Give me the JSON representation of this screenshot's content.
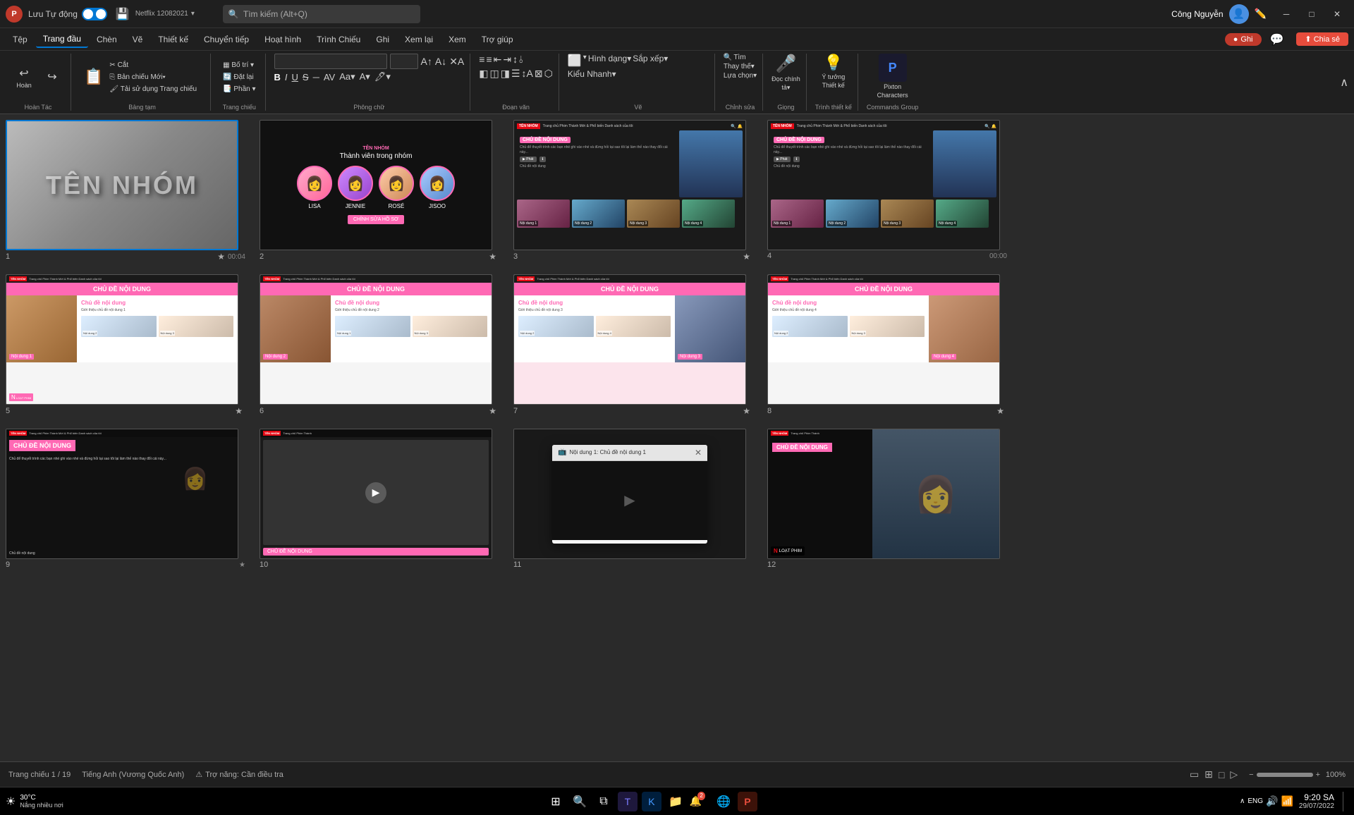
{
  "titlebar": {
    "logo": "P",
    "autosave_label": "Lưu Tự động",
    "save_icon": "💾",
    "filename": "Netflix 12082021",
    "dropdown_icon": "▾",
    "search_placeholder": "Tìm kiếm (Alt+Q)",
    "username": "Công Nguyễn",
    "minimize": "─",
    "maximize": "□",
    "close": "✕"
  },
  "menubar": {
    "items": [
      "Tệp",
      "Trang đầu",
      "Chèn",
      "Vẽ",
      "Thiết kế",
      "Chuyển tiếp",
      "Hoạt hình",
      "Trình Chiếu",
      "Ghi",
      "Xem lại",
      "Xem",
      "Trợ giúp"
    ],
    "active": "Trang đầu",
    "record_btn": "● Ghi",
    "comment_icon": "💬",
    "share_btn": "⬆ Chia sẻ"
  },
  "ribbon": {
    "undo": "↩",
    "redo": "↪",
    "groups": [
      {
        "name": "Hoàn Tác"
      },
      {
        "name": "Bảng tạm"
      },
      {
        "name": "Trang chiếu"
      },
      {
        "name": "Phông chữ"
      },
      {
        "name": "Đoạn văn"
      },
      {
        "name": "Vẽ"
      },
      {
        "name": "Chỉnh sửa"
      },
      {
        "name": "Giọng"
      },
      {
        "name": "Trình thiết kế"
      },
      {
        "name": "Commands Group"
      }
    ],
    "font_name": "",
    "font_size": "",
    "bold": "B",
    "italic": "I",
    "underline": "U",
    "strikethrough": "S"
  },
  "slides": [
    {
      "num": 1,
      "time": "00:04",
      "has_star": true,
      "type": "cover",
      "title": "TÊN NHÓM"
    },
    {
      "num": 2,
      "time": "",
      "has_star": true,
      "type": "members",
      "title": "Thành viên trong nhóm",
      "members": [
        "LISA",
        "JENNIE",
        "ROSÉ",
        "JISOO"
      ],
      "btn": "CHỈNH SỬA HỒ SƠ"
    },
    {
      "num": 3,
      "time": "",
      "has_star": true,
      "type": "netflix",
      "subject": "CHỦ ĐỀ NỘI DUNG",
      "thumbs": [
        "Nội dung 1",
        "Nội dung 2",
        "Nội dung 3",
        "Nội dung 4"
      ]
    },
    {
      "num": 4,
      "time": "00:00",
      "has_star": false,
      "type": "netflix",
      "subject": "CHỦ ĐỀ NỘI DUNG",
      "thumbs": [
        "Nội dung 1",
        "Nội dung 2",
        "Nội dung 3",
        "Nội dung 4"
      ]
    },
    {
      "num": 5,
      "time": "",
      "has_star": true,
      "type": "content",
      "subject": "CHỦ ĐỀ NỘI DUNG",
      "subtitle": "Chủ đề nội dung",
      "label": "Nội dung 1",
      "thumbs": [
        "Nội dung 2",
        "Nội dung 3"
      ]
    },
    {
      "num": 6,
      "time": "",
      "has_star": true,
      "type": "content",
      "subject": "CHỦ ĐỀ NỘI DUNG",
      "subtitle": "Chủ đề nội dung",
      "label": "Nội dung 2",
      "thumbs": [
        "Nội dung 1",
        "Nội dung 3"
      ]
    },
    {
      "num": 7,
      "time": "",
      "has_star": true,
      "type": "content",
      "subject": "CHỦ ĐỀ NỘI DUNG",
      "subtitle": "Chủ đề nội dung",
      "label": "Nội dung 3",
      "thumbs": [
        "Nội dung 2",
        "Nội dung 4"
      ]
    },
    {
      "num": 8,
      "time": "",
      "has_star": true,
      "type": "content",
      "subject": "CHỦ ĐỀ NỘI DUNG",
      "subtitle": "Chủ đề nội dung",
      "label": "Nội dung 4",
      "thumbs": [
        "Nội dung 2",
        "Nội dung 3"
      ]
    },
    {
      "num": 9,
      "time": "",
      "has_star": false,
      "type": "content-only",
      "subject": "CHỦ ĐỀ NỘI DUNG"
    },
    {
      "num": 10,
      "time": "",
      "has_star": false,
      "type": "content-movie",
      "subject": "CHỦ ĐỀ NỘI DUNG"
    },
    {
      "num": 11,
      "time": "",
      "has_star": false,
      "type": "video-popup",
      "popup_title": "Nội dung 1: Chủ đề nội dung 1"
    },
    {
      "num": 12,
      "time": "",
      "has_star": false,
      "type": "content-movie2",
      "subject": "CHỦ ĐỀ NỘI DUNG"
    }
  ],
  "statusbar": {
    "slide_info": "Trang chiếu 1 / 19",
    "language": "Tiếng Anh (Vương Quốc Anh)",
    "accessibility": "Trợ năng: Cần điều tra",
    "view_normal": "▭",
    "view_slide_sorter": "⊞",
    "view_reading": "□",
    "view_slideshow": "▷",
    "zoom": "100%"
  },
  "taskbar": {
    "weather_temp": "30°C",
    "weather_desc": "Nắng nhiều nơi",
    "time": "9:20 SA",
    "date": "29/07/2022",
    "lang": "ENG"
  }
}
